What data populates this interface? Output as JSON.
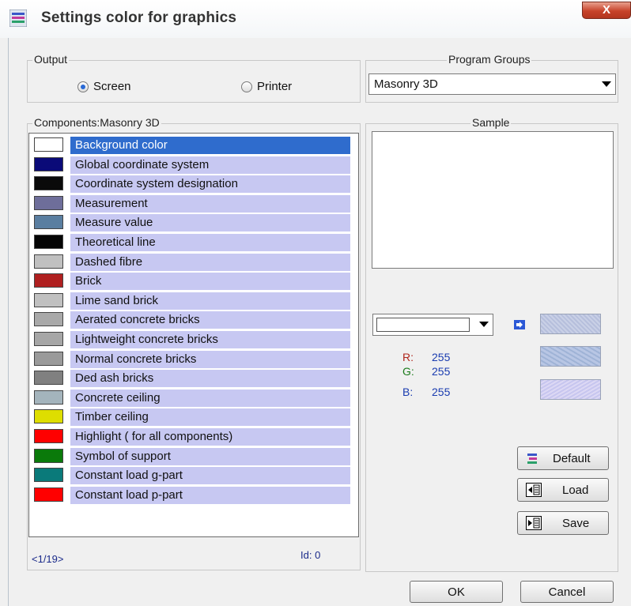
{
  "window": {
    "title": "Settings color for graphics",
    "close_glyph": "X"
  },
  "output": {
    "label": "Output",
    "options": [
      {
        "label": "Screen",
        "selected": true
      },
      {
        "label": "Printer",
        "selected": false
      }
    ]
  },
  "program_groups": {
    "label": "Program Groups",
    "selected": "Masonry 3D"
  },
  "components": {
    "label": "Components:Masonry 3D",
    "items": [
      {
        "label": "Background color",
        "color": "#ffffff",
        "selected": true
      },
      {
        "label": "Global coordinate system",
        "color": "#0a0a78"
      },
      {
        "label": "Coordinate system designation",
        "color": "#0a0a0a"
      },
      {
        "label": "Measurement",
        "color": "#6e6e9a"
      },
      {
        "label": "Measure value",
        "color": "#5a7ea0"
      },
      {
        "label": "Theoretical line",
        "color": "#050505"
      },
      {
        "label": "Dashed fibre",
        "color": "#c0c0c0"
      },
      {
        "label": "Brick",
        "color": "#b02020"
      },
      {
        "label": "Lime sand brick",
        "color": "#c0c0c0"
      },
      {
        "label": "Aerated concrete bricks",
        "color": "#a9a9a9"
      },
      {
        "label": "Lightweight concrete bricks",
        "color": "#a6a6a6"
      },
      {
        "label": "Normal concrete bricks",
        "color": "#9a9a9a"
      },
      {
        "label": "Ded ash bricks",
        "color": "#808080"
      },
      {
        "label": "Concrete ceiling",
        "color": "#a4b4bc"
      },
      {
        "label": "Timber ceiling",
        "color": "#dede00"
      },
      {
        "label": "Highlight ( for all components)",
        "color": "#ff0000"
      },
      {
        "label": "Symbol of support",
        "color": "#0a7a0a"
      },
      {
        "label": "Constant load g-part",
        "color": "#0a7a7a"
      },
      {
        "label": "Constant load p-part",
        "color": "#ff0000"
      }
    ],
    "page": "<1/19>",
    "id": "Id: 0"
  },
  "sample": {
    "label": "Sample"
  },
  "color": {
    "current": "#ffffff",
    "r_label": "R:",
    "r": "255",
    "g_label": "G:",
    "g": "255",
    "b_label": "B:",
    "b": "255"
  },
  "buttons": {
    "default": "Default",
    "load": "Load",
    "save": "Save",
    "ok": "OK",
    "cancel": "Cancel"
  },
  "icons": {
    "title": "palette-icon",
    "arrow": "arrow-right-icon",
    "default": "palette-icon",
    "load": "load-icon",
    "save": "save-icon"
  }
}
